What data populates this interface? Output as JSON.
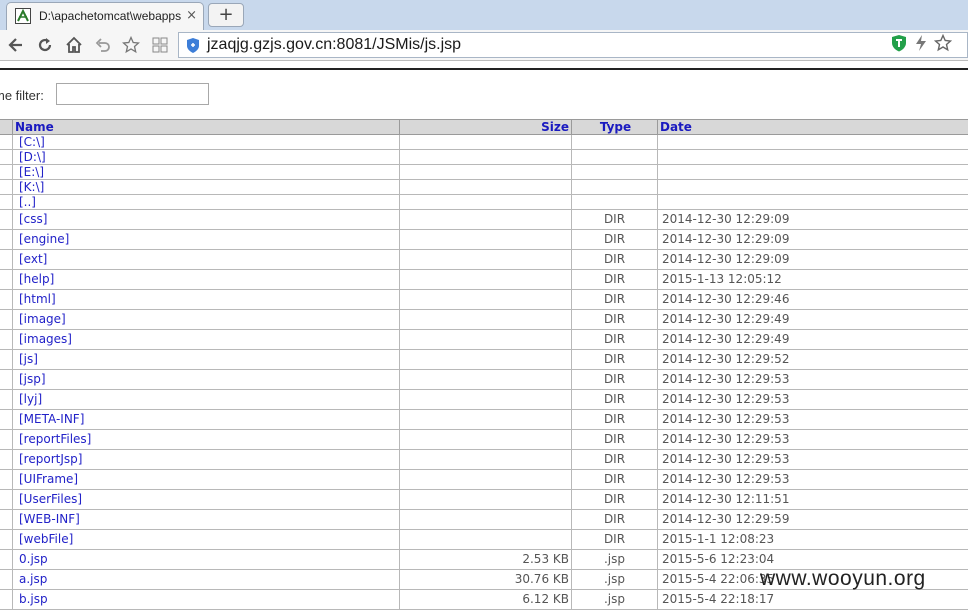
{
  "browser": {
    "tab_title": "D:\\apachetomcat\\webapps",
    "tab_close": "×",
    "new_tab": "+",
    "url": "jzaqjg.gzjs.gov.cn:8081/JSMis/js.jsp"
  },
  "filter": {
    "label": "me filter:",
    "value": ""
  },
  "table": {
    "headers": {
      "name": "Name",
      "size": "Size",
      "type": "Type",
      "date": "Date"
    },
    "drives": [
      "[C:\\]",
      "[D:\\]",
      "[E:\\]",
      "[K:\\]",
      "[..]"
    ],
    "rows": [
      {
        "name": "[css]",
        "size": "",
        "type": "DIR",
        "date": "2014-12-30 12:29:09"
      },
      {
        "name": "[engine]",
        "size": "",
        "type": "DIR",
        "date": "2014-12-30 12:29:09"
      },
      {
        "name": "[ext]",
        "size": "",
        "type": "DIR",
        "date": "2014-12-30 12:29:09"
      },
      {
        "name": "[help]",
        "size": "",
        "type": "DIR",
        "date": "2015-1-13 12:05:12"
      },
      {
        "name": "[html]",
        "size": "",
        "type": "DIR",
        "date": "2014-12-30 12:29:46"
      },
      {
        "name": "[image]",
        "size": "",
        "type": "DIR",
        "date": "2014-12-30 12:29:49"
      },
      {
        "name": "[images]",
        "size": "",
        "type": "DIR",
        "date": "2014-12-30 12:29:49"
      },
      {
        "name": "[js]",
        "size": "",
        "type": "DIR",
        "date": "2014-12-30 12:29:52"
      },
      {
        "name": "[jsp]",
        "size": "",
        "type": "DIR",
        "date": "2014-12-30 12:29:53"
      },
      {
        "name": "[lyj]",
        "size": "",
        "type": "DIR",
        "date": "2014-12-30 12:29:53"
      },
      {
        "name": "[META-INF]",
        "size": "",
        "type": "DIR",
        "date": "2014-12-30 12:29:53"
      },
      {
        "name": "[reportFiles]",
        "size": "",
        "type": "DIR",
        "date": "2014-12-30 12:29:53"
      },
      {
        "name": "[reportJsp]",
        "size": "",
        "type": "DIR",
        "date": "2014-12-30 12:29:53"
      },
      {
        "name": "[UIFrame]",
        "size": "",
        "type": "DIR",
        "date": "2014-12-30 12:29:53"
      },
      {
        "name": "[UserFiles]",
        "size": "",
        "type": "DIR",
        "date": "2014-12-30 12:11:51"
      },
      {
        "name": "[WEB-INF]",
        "size": "",
        "type": "DIR",
        "date": "2014-12-30 12:29:59"
      },
      {
        "name": "[webFile]",
        "size": "",
        "type": "DIR",
        "date": "2015-1-1 12:08:23"
      },
      {
        "name": "0.jsp",
        "size": "2.53 KB",
        "type": ".jsp",
        "date": "2015-5-6 12:23:04"
      },
      {
        "name": "a.jsp",
        "size": "30.76 KB",
        "type": ".jsp",
        "date": "2015-5-4 22:06:35"
      },
      {
        "name": "b.jsp",
        "size": "6.12 KB",
        "type": ".jsp",
        "date": "2015-5-4 22:18:17"
      }
    ]
  },
  "watermark": "www.wooyun.org"
}
